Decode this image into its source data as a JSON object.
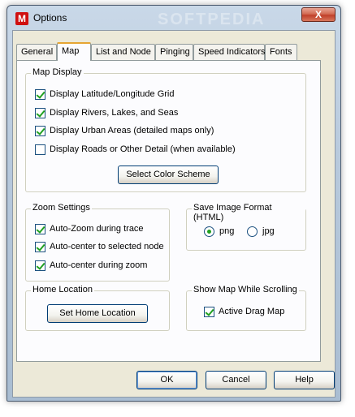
{
  "window": {
    "title": "Options",
    "app_icon_letter": "M",
    "close_glyph": "X",
    "watermark": "SOFTPEDIA"
  },
  "tabs": [
    {
      "label": "General",
      "active": false
    },
    {
      "label": "Map",
      "active": true
    },
    {
      "label": "List and Node",
      "active": false
    },
    {
      "label": "Pinging",
      "active": false
    },
    {
      "label": "Speed Indicators",
      "active": false
    },
    {
      "label": "Fonts",
      "active": false
    }
  ],
  "map_display": {
    "label": "Map Display",
    "options": [
      {
        "label": "Display Latitude/Longitude Grid",
        "checked": true
      },
      {
        "label": "Display Rivers, Lakes, and Seas",
        "checked": true
      },
      {
        "label": "Display Urban Areas (detailed maps only)",
        "checked": true
      },
      {
        "label": "Display Roads or Other Detail (when available)",
        "checked": false
      }
    ],
    "color_scheme_button": "Select Color Scheme"
  },
  "zoom_settings": {
    "label": "Zoom Settings",
    "options": [
      {
        "label": "Auto-Zoom during trace",
        "checked": true
      },
      {
        "label": "Auto-center to selected node",
        "checked": true
      },
      {
        "label": "Auto-center during zoom",
        "checked": true
      }
    ]
  },
  "save_image_format": {
    "label": "Save Image Format (HTML)",
    "options": [
      {
        "label": "png",
        "selected": true
      },
      {
        "label": "jpg",
        "selected": false
      }
    ]
  },
  "home_location": {
    "label": "Home Location",
    "button": "Set Home Location"
  },
  "show_map_scrolling": {
    "label": "Show Map While Scrolling",
    "option": {
      "label": "Active Drag Map",
      "checked": true
    }
  },
  "footer": {
    "ok": "OK",
    "cancel": "Cancel",
    "help": "Help"
  }
}
